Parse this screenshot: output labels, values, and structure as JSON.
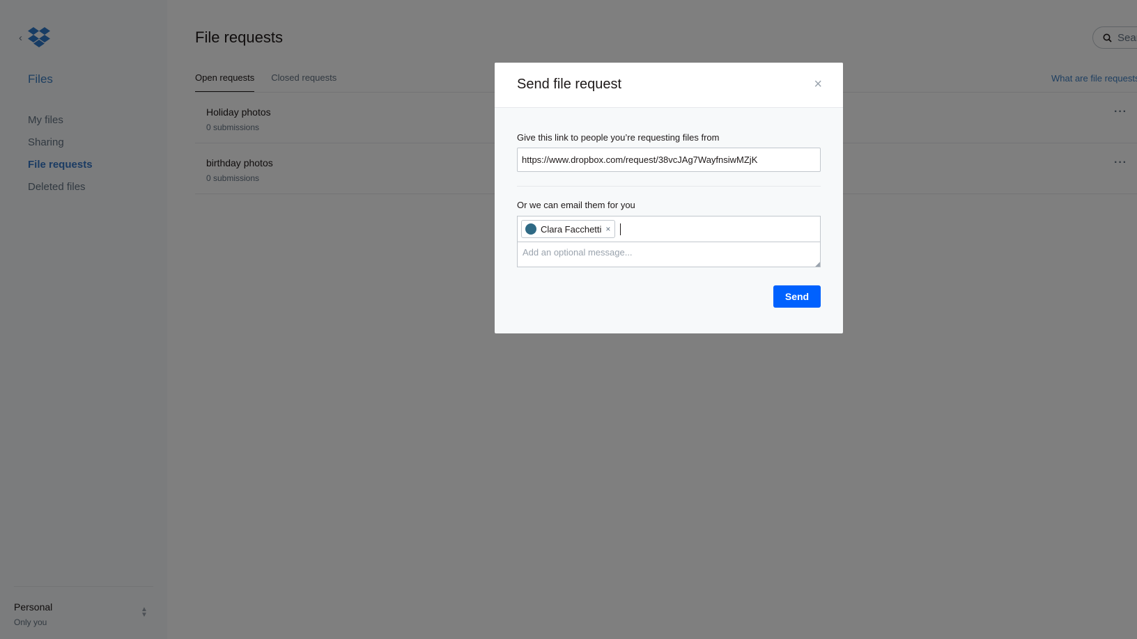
{
  "sidebar": {
    "title": "Files",
    "items": [
      {
        "label": "My files"
      },
      {
        "label": "Sharing"
      },
      {
        "label": "File requests"
      },
      {
        "label": "Deleted files"
      }
    ],
    "account": {
      "name": "Personal",
      "sub": "Only you"
    }
  },
  "header": {
    "title": "File requests",
    "search_label": "Sear"
  },
  "tabs": [
    {
      "label": "Open requests"
    },
    {
      "label": "Closed requests"
    }
  ],
  "help_link": "What are file requests",
  "requests": [
    {
      "name": "Holiday photos",
      "submissions": "0 submissions"
    },
    {
      "name": "birthday photos",
      "submissions": "0 submissions"
    }
  ],
  "modal": {
    "title": "Send file request",
    "close_glyph": "×",
    "link_label": "Give this link to people you’re requesting files from",
    "link_value": "https://www.dropbox.com/request/38vcJAg7WayfnsiwMZjK",
    "email_label": "Or we can email them for you",
    "recipient": "Clara Facchetti",
    "recipient_remove": "×",
    "message_placeholder": "Add an optional message...",
    "send_label": "Send"
  },
  "colors": {
    "primary": "#0061fe",
    "link": "#3d7ec2",
    "avatar": "#2f6a85"
  }
}
